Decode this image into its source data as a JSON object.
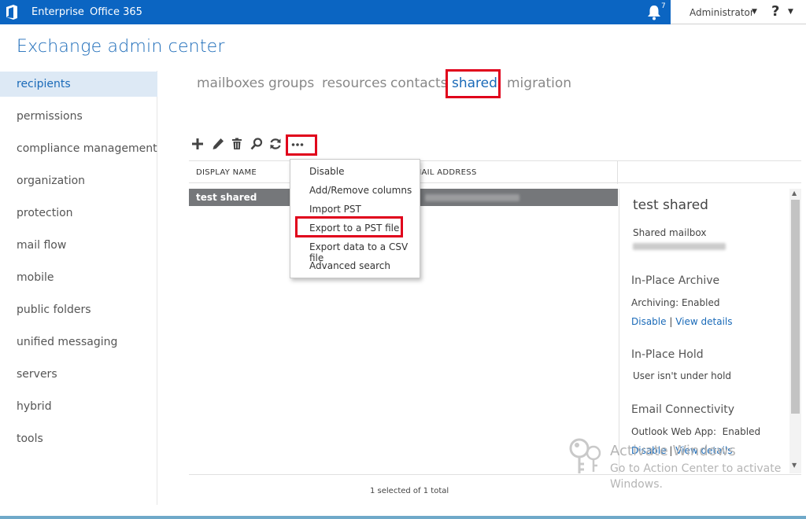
{
  "topbar": {
    "nav": [
      "Enterprise",
      "Office 365"
    ],
    "notification_count": "7",
    "user": "Administrator",
    "help": "?"
  },
  "app_title": "Exchange admin center",
  "sidebar": {
    "items": [
      {
        "label": "recipients",
        "selected": true
      },
      {
        "label": "permissions"
      },
      {
        "label": "compliance management"
      },
      {
        "label": "organization"
      },
      {
        "label": "protection"
      },
      {
        "label": "mail flow"
      },
      {
        "label": "mobile"
      },
      {
        "label": "public folders"
      },
      {
        "label": "unified messaging"
      },
      {
        "label": "servers"
      },
      {
        "label": "hybrid"
      },
      {
        "label": "tools"
      }
    ]
  },
  "tabs": [
    {
      "label": "mailboxes"
    },
    {
      "label": "groups"
    },
    {
      "label": "resources"
    },
    {
      "label": "contacts"
    },
    {
      "label": "shared",
      "active": true
    },
    {
      "label": "migration"
    }
  ],
  "toolbar": {
    "icons": [
      "add-icon",
      "edit-icon",
      "delete-icon",
      "search-icon",
      "refresh-icon",
      "more-icon"
    ]
  },
  "grid": {
    "columns": [
      "DISPLAY NAME",
      "EMAIL ADDRESS"
    ],
    "rows": [
      {
        "display_name": "test shared",
        "selected": true
      }
    ],
    "status": "1 selected of 1 total"
  },
  "more_menu": {
    "items": [
      "Disable",
      "Add/Remove columns",
      "Import PST",
      "Export to a PST file",
      "Export data to a CSV file",
      "Advanced search"
    ],
    "highlighted": "Export to a PST file"
  },
  "details": {
    "title": "test shared",
    "type": "Shared mailbox",
    "archive_heading": "In-Place Archive",
    "archiving_label": "Archiving:",
    "archiving_value": "Enabled",
    "archive_links": [
      "Disable",
      "View details"
    ],
    "hold_heading": "In-Place Hold",
    "hold_status": "User isn't under hold",
    "connectivity_heading": "Email Connectivity",
    "owa_label": "Outlook Web App:",
    "owa_value": "Enabled",
    "owa_links": [
      "Disable",
      "View details"
    ],
    "link_separator": "|"
  },
  "watermark": {
    "line1": "Activate Windows",
    "line2": "Go to Action Center to activate",
    "line3": "Windows."
  },
  "colors": {
    "topbar": "#0b65c2",
    "accent": "#1a6ab8",
    "highlight_box": "#e0001b",
    "selected_row": "#75777a"
  }
}
